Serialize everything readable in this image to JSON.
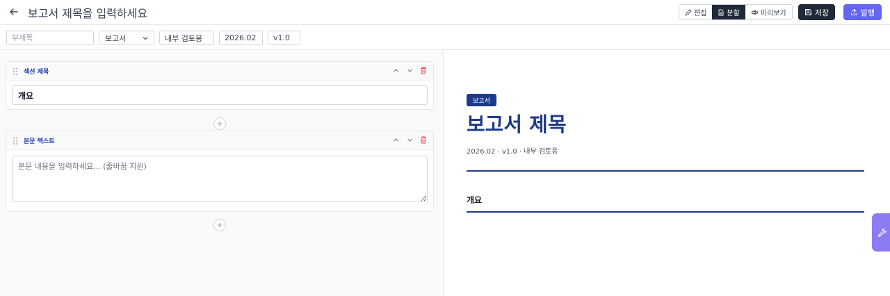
{
  "header": {
    "title": "보고서 제목을 입력하세요",
    "view_modes": [
      {
        "label": "편집",
        "icon": "pencil-icon",
        "active": false
      },
      {
        "label": "분할",
        "icon": "document-icon",
        "active": true
      },
      {
        "label": "미리보기",
        "icon": "eye-icon",
        "active": false
      }
    ],
    "save_label": "저장",
    "publish_label": "발행"
  },
  "meta": {
    "subtitle_placeholder": "부제목",
    "doc_type": "보고서",
    "audience": "내부 검토용",
    "date": "2026.02",
    "version": "v1.0"
  },
  "blocks": [
    {
      "type_label": "섹션 제목",
      "value": "개요"
    },
    {
      "type_label": "본문 텍스트",
      "value": "",
      "placeholder": "본문 내용을 입력하세요... (줄바꿈 지원)"
    }
  ],
  "preview": {
    "badge": "보고서",
    "title": "보고서 제목",
    "meta_line": "2026.02 · v1.0 · 내부 검토용",
    "section_heading": "개요"
  },
  "colors": {
    "primary_navy": "#1e3a8a",
    "dark": "#1f2937",
    "accent_indigo": "#6366f1",
    "delete_red": "#ef4444",
    "fab_purple": "#8b7cf6"
  }
}
